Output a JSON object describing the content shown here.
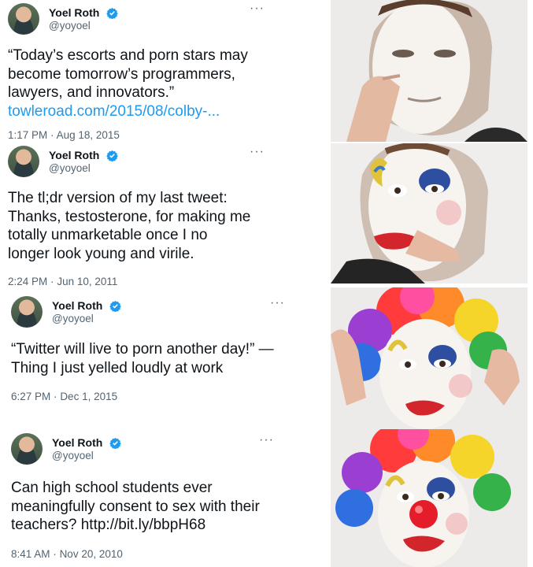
{
  "tweets": [
    {
      "name": "Yoel Roth",
      "handle": "@yoyoel",
      "text": "“Today’s escorts and porn stars may become tomorrow’s programmers, lawyers, and innovators.”",
      "link": "towleroad.com/2015/08/colby-...",
      "time": "1:17 PM",
      "date": "Aug 18, 2015"
    },
    {
      "name": "Yoel Roth",
      "handle": "@yoyoel",
      "text": "The tl;dr version of my last tweet: Thanks, testosterone, for making me totally unmarketable once I no longer look young and virile.",
      "time": "2:24 PM",
      "date": "Jun 10, 2011"
    },
    {
      "name": "Yoel Roth",
      "handle": "@yoyoel",
      "text": "“Twitter will live to porn another day!” —Thing I just yelled loudly at work",
      "time": "6:27 PM",
      "date": "Dec 1, 2015"
    },
    {
      "name": "Yoel Roth",
      "handle": "@yoyoel",
      "text": "Can high school students ever meaningfully consent to sex with their teachers? http://bit.ly/bbpH68",
      "time": "8:41 AM",
      "date": "Nov 20, 2010"
    }
  ],
  "separator": "·",
  "more_glyph": "···",
  "colors": {
    "verified": "#1d9bf0",
    "link": "#1d9bf0",
    "muted": "#536471"
  },
  "icons": [
    "verified-badge-icon",
    "more-options-icon"
  ],
  "meme_panels": [
    {
      "stage": "white-face-paint"
    },
    {
      "stage": "clown-makeup-applied"
    },
    {
      "stage": "rainbow-wig"
    },
    {
      "stage": "red-nose-full-clown"
    }
  ]
}
